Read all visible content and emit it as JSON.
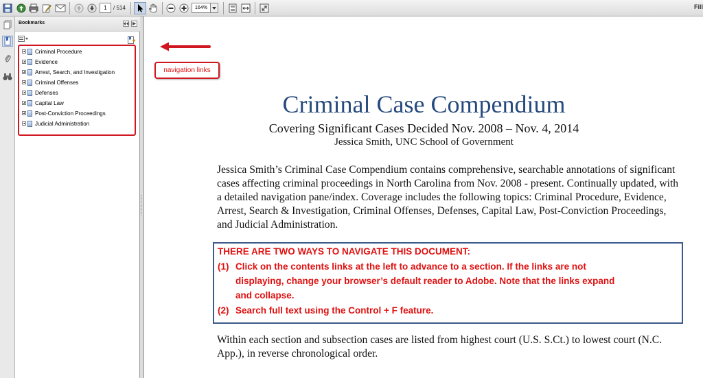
{
  "toolbar": {
    "page_current": "1",
    "page_total": "/ 514",
    "zoom": "164%",
    "right_label": "Fill"
  },
  "bookmarks_panel": {
    "title": "Bookmarks",
    "items": [
      {
        "label": "Criminal Procedure"
      },
      {
        "label": "Evidence"
      },
      {
        "label": "Arrest, Search, and Investigation"
      },
      {
        "label": "Criminal Offenses"
      },
      {
        "label": "Defenses"
      },
      {
        "label": "Capital Law"
      },
      {
        "label": "Post-Conviction Proceedings"
      },
      {
        "label": "Judicial Administration"
      }
    ]
  },
  "annotation": {
    "label": "navigation links",
    "color": "#e01010"
  },
  "document": {
    "title": "Criminal Case Compendium",
    "subtitle": "Covering Significant Cases Decided Nov. 2008 – Nov. 4, 2014",
    "author": "Jessica Smith, UNC School of Government",
    "intro": "Jessica Smith’s Criminal Case Compendium contains comprehensive, searchable annotations of significant cases affecting criminal proceedings in North Carolina from Nov. 2008 - present. Continually updated, with a detailed navigation pane/index. Coverage includes the following topics: Criminal Procedure, Evidence, Arrest, Search & Investigation, Criminal Offenses, Defenses, Capital Law, Post-Conviction Proceedings, and Judicial Administration.",
    "notice": {
      "heading": "THERE ARE TWO WAYS TO NAVIGATE THIS DOCUMENT:",
      "item1_num": "(1)",
      "item1_line1": "Click on the contents links at the left to advance to a section. If the links are not",
      "item1_line2": "displaying, change your browser’s default reader to Adobe. Note that the links expand",
      "item1_line3": "and collapse.",
      "item2_num": "(2)",
      "item2_line1": "Search full text using the Control + F feature."
    },
    "closing": "Within each section and subsection cases are listed from highest court (U.S. S.Ct.) to lowest court (N.C. App.), in reverse chronological order."
  },
  "colors": {
    "title_blue": "#264a7d",
    "highlight_red": "#d0161e",
    "notice_border": "#3b5a8a"
  }
}
